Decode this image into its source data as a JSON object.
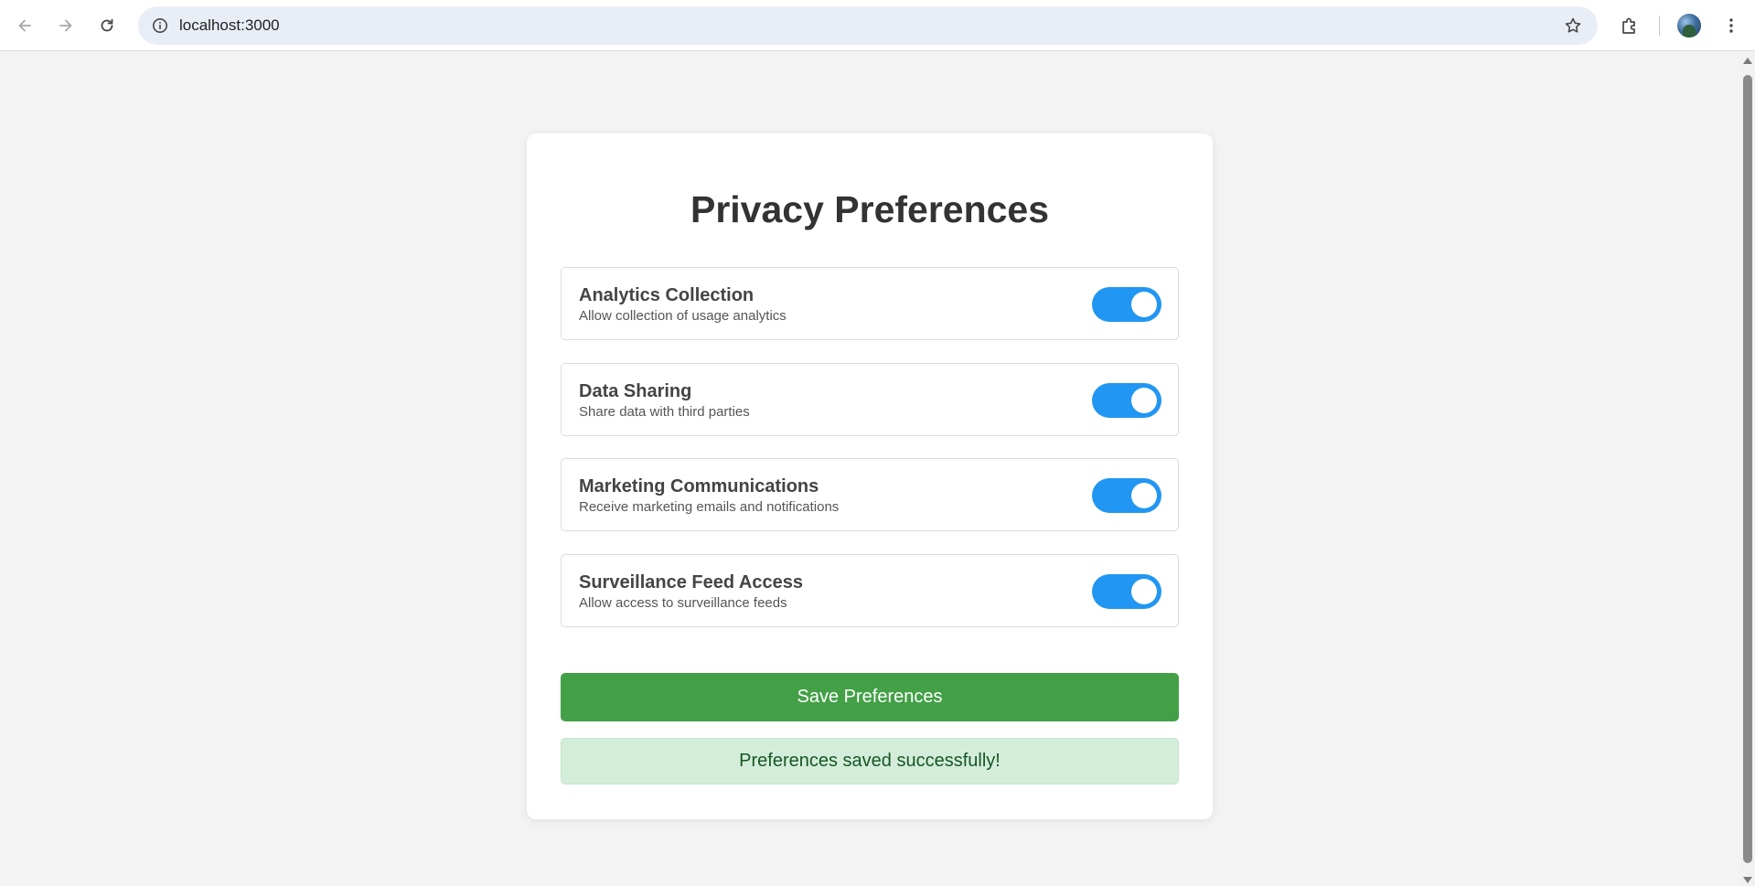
{
  "browser": {
    "url": "localhost:3000",
    "icons": [
      "back-arrow-icon",
      "forward-arrow-icon",
      "reload-icon",
      "site-info-icon",
      "bookmark-star-icon",
      "extensions-icon",
      "profile-avatar",
      "more-menu-icon"
    ]
  },
  "page": {
    "title": "Privacy Preferences",
    "preferences": [
      {
        "title": "Analytics Collection",
        "description": "Allow collection of usage analytics",
        "enabled": true
      },
      {
        "title": "Data Sharing",
        "description": "Share data with third parties",
        "enabled": true
      },
      {
        "title": "Marketing Communications",
        "description": "Receive marketing emails and notifications",
        "enabled": true
      },
      {
        "title": "Surveillance Feed Access",
        "description": "Allow access to surveillance feeds",
        "enabled": true
      }
    ],
    "save_label": "Save Preferences",
    "success_message": "Preferences saved successfully!"
  },
  "colors": {
    "toggle_on": "#2196f3",
    "save_button": "#43a047",
    "success_bg": "#d4edda",
    "success_text": "#155724"
  }
}
